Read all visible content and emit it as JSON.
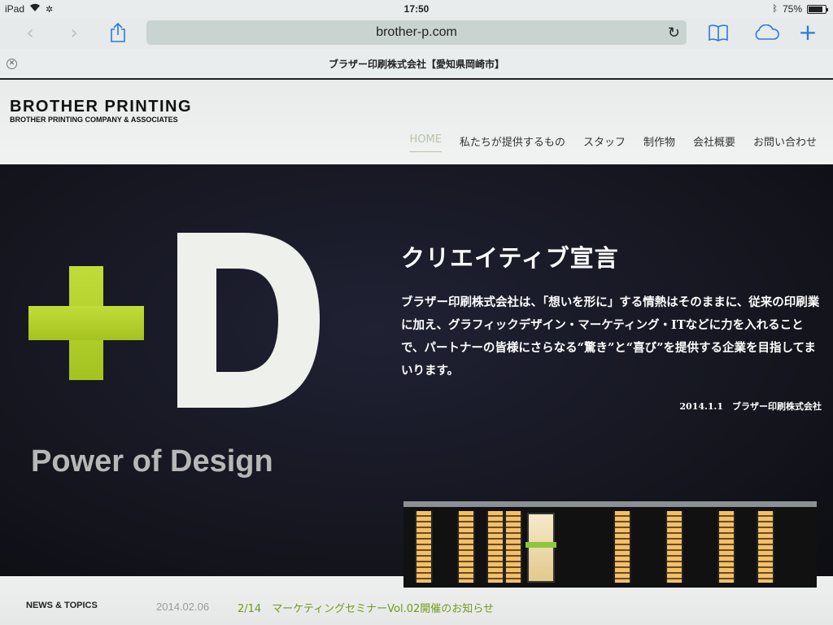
{
  "status": {
    "device": "iPad",
    "time": "17:50",
    "battery": "75%"
  },
  "browser": {
    "url": "brother-p.com",
    "page_title": "ブラザー印刷株式会社【愛知県岡崎市】"
  },
  "site": {
    "logo_main": "BROTHER PRINTING",
    "logo_sub": "BROTHER PRINTING COMPANY & ASSOCIATES",
    "nav": [
      "HOME",
      "私たちが提供するもの",
      "スタッフ",
      "制作物",
      "会社概要",
      "お問い合わせ"
    ]
  },
  "hero": {
    "letter": "D",
    "tagline": "Power of Design",
    "title": "クリエイティブ宣言",
    "body": "ブラザー印刷株式会社は、「想いを形に」する情熱はそのままに、従来の印刷業に加え、グラフィックデザイン・マーケティング・ITなどに力を入れることで、パートナーの皆様にさらなる“驚き”と“喜び”を提供する企業を目指してまいります。",
    "signature": "2014.1.1　ブラザー印刷株式会社"
  },
  "news": {
    "label": "NEWS & TOPICS",
    "date": "2014.02.06",
    "item": "2/14　マーケティングセミナーVol.02開催のお知らせ"
  },
  "colors": {
    "accent_green": "#b2cf2c",
    "safari_blue": "#2d7ad6",
    "hero_bg": "#17182a"
  }
}
